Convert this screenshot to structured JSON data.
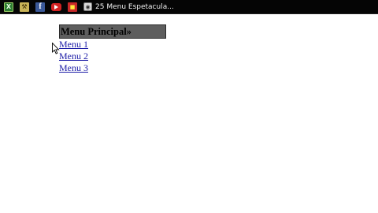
{
  "taskbar": {
    "icons": [
      "excel-icon",
      "tools-icon",
      "facebook-icon",
      "youtube-icon",
      "red-app-icon"
    ],
    "active_task": {
      "icon": "document-icon",
      "title": "25 Menu Espetacula..."
    }
  },
  "menu": {
    "title": "Menu Principal»",
    "items": [
      {
        "label": "Menu 1"
      },
      {
        "label": "Menu 2"
      },
      {
        "label": "Menu 3"
      }
    ]
  },
  "colors": {
    "taskbar_bg": "#050505",
    "menu_header_bg": "#5e5e5e",
    "link": "#1a1aa6"
  }
}
